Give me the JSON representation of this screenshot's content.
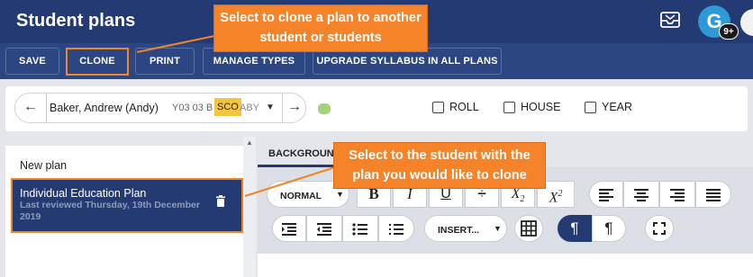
{
  "header": {
    "title": "Student plans",
    "avatar_letter": "G",
    "avatar_badge": "9+"
  },
  "toolbar": {
    "buttons": [
      "SAVE",
      "CLONE",
      "PRINT",
      "MANAGE TYPES",
      "UPGRADE SYLLABUS IN ALL PLANS"
    ]
  },
  "student_bar": {
    "student_name": "Baker, Andrew (Andy)",
    "code_prefix": "Y03 03 B",
    "code_highlight": "SCO",
    "code_suffix": "ABY",
    "checkboxes": [
      "ROLL",
      "HOUSE",
      "YEAR"
    ]
  },
  "sidebar": {
    "new_plan_label": "New plan",
    "plan_title": "Individual Education Plan",
    "plan_subtitle": "Last reviewed Thursday, 19th December 2019"
  },
  "editor": {
    "tab_label": "BACKGROUND",
    "format_select": "NORMAL",
    "insert_select": "INSERT..."
  },
  "callouts": {
    "clone": "Select to clone a plan to another student or students",
    "student": "Select to the student with the plan you would like to clone"
  },
  "colors": {
    "header_bg": "#243a73",
    "toolbar_bg": "#2c4684",
    "callout": "#f5832a",
    "highlight": "#f5c542"
  }
}
